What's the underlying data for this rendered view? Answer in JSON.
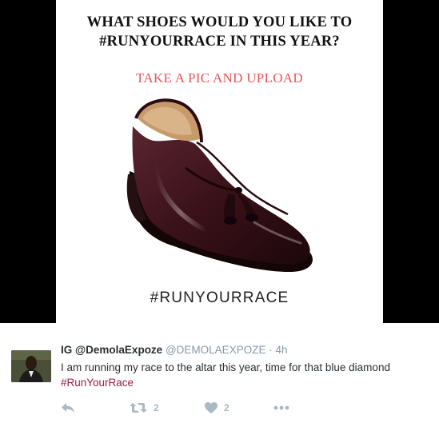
{
  "poster": {
    "headline_line1": "WHAT SHOES WOULD YOU LIKE TO",
    "headline_line2": "#RUNYOURRACE IN THIS YEAR?",
    "cta": "TAKE A PIC AND  UPLOAD",
    "hashtag": "#RUNYOURRACE",
    "cta_color": "#e8565a"
  },
  "tweet": {
    "name": "IG @DemolaExpoze",
    "handle": "@DEMOLAEXPOZE",
    "separator": "·",
    "time": "4h",
    "text_before": "I am running my race to the altar this year, time for that blue diamond ",
    "hashtag": "#RunYourRace",
    "hashtag_color": "#9b1d48"
  },
  "actions": {
    "reply_icon": "reply-icon",
    "retweet_icon": "retweet-icon",
    "retweet_count": "2",
    "like_icon": "heart-icon",
    "like_count": "2",
    "more_icon": "more-icon"
  }
}
